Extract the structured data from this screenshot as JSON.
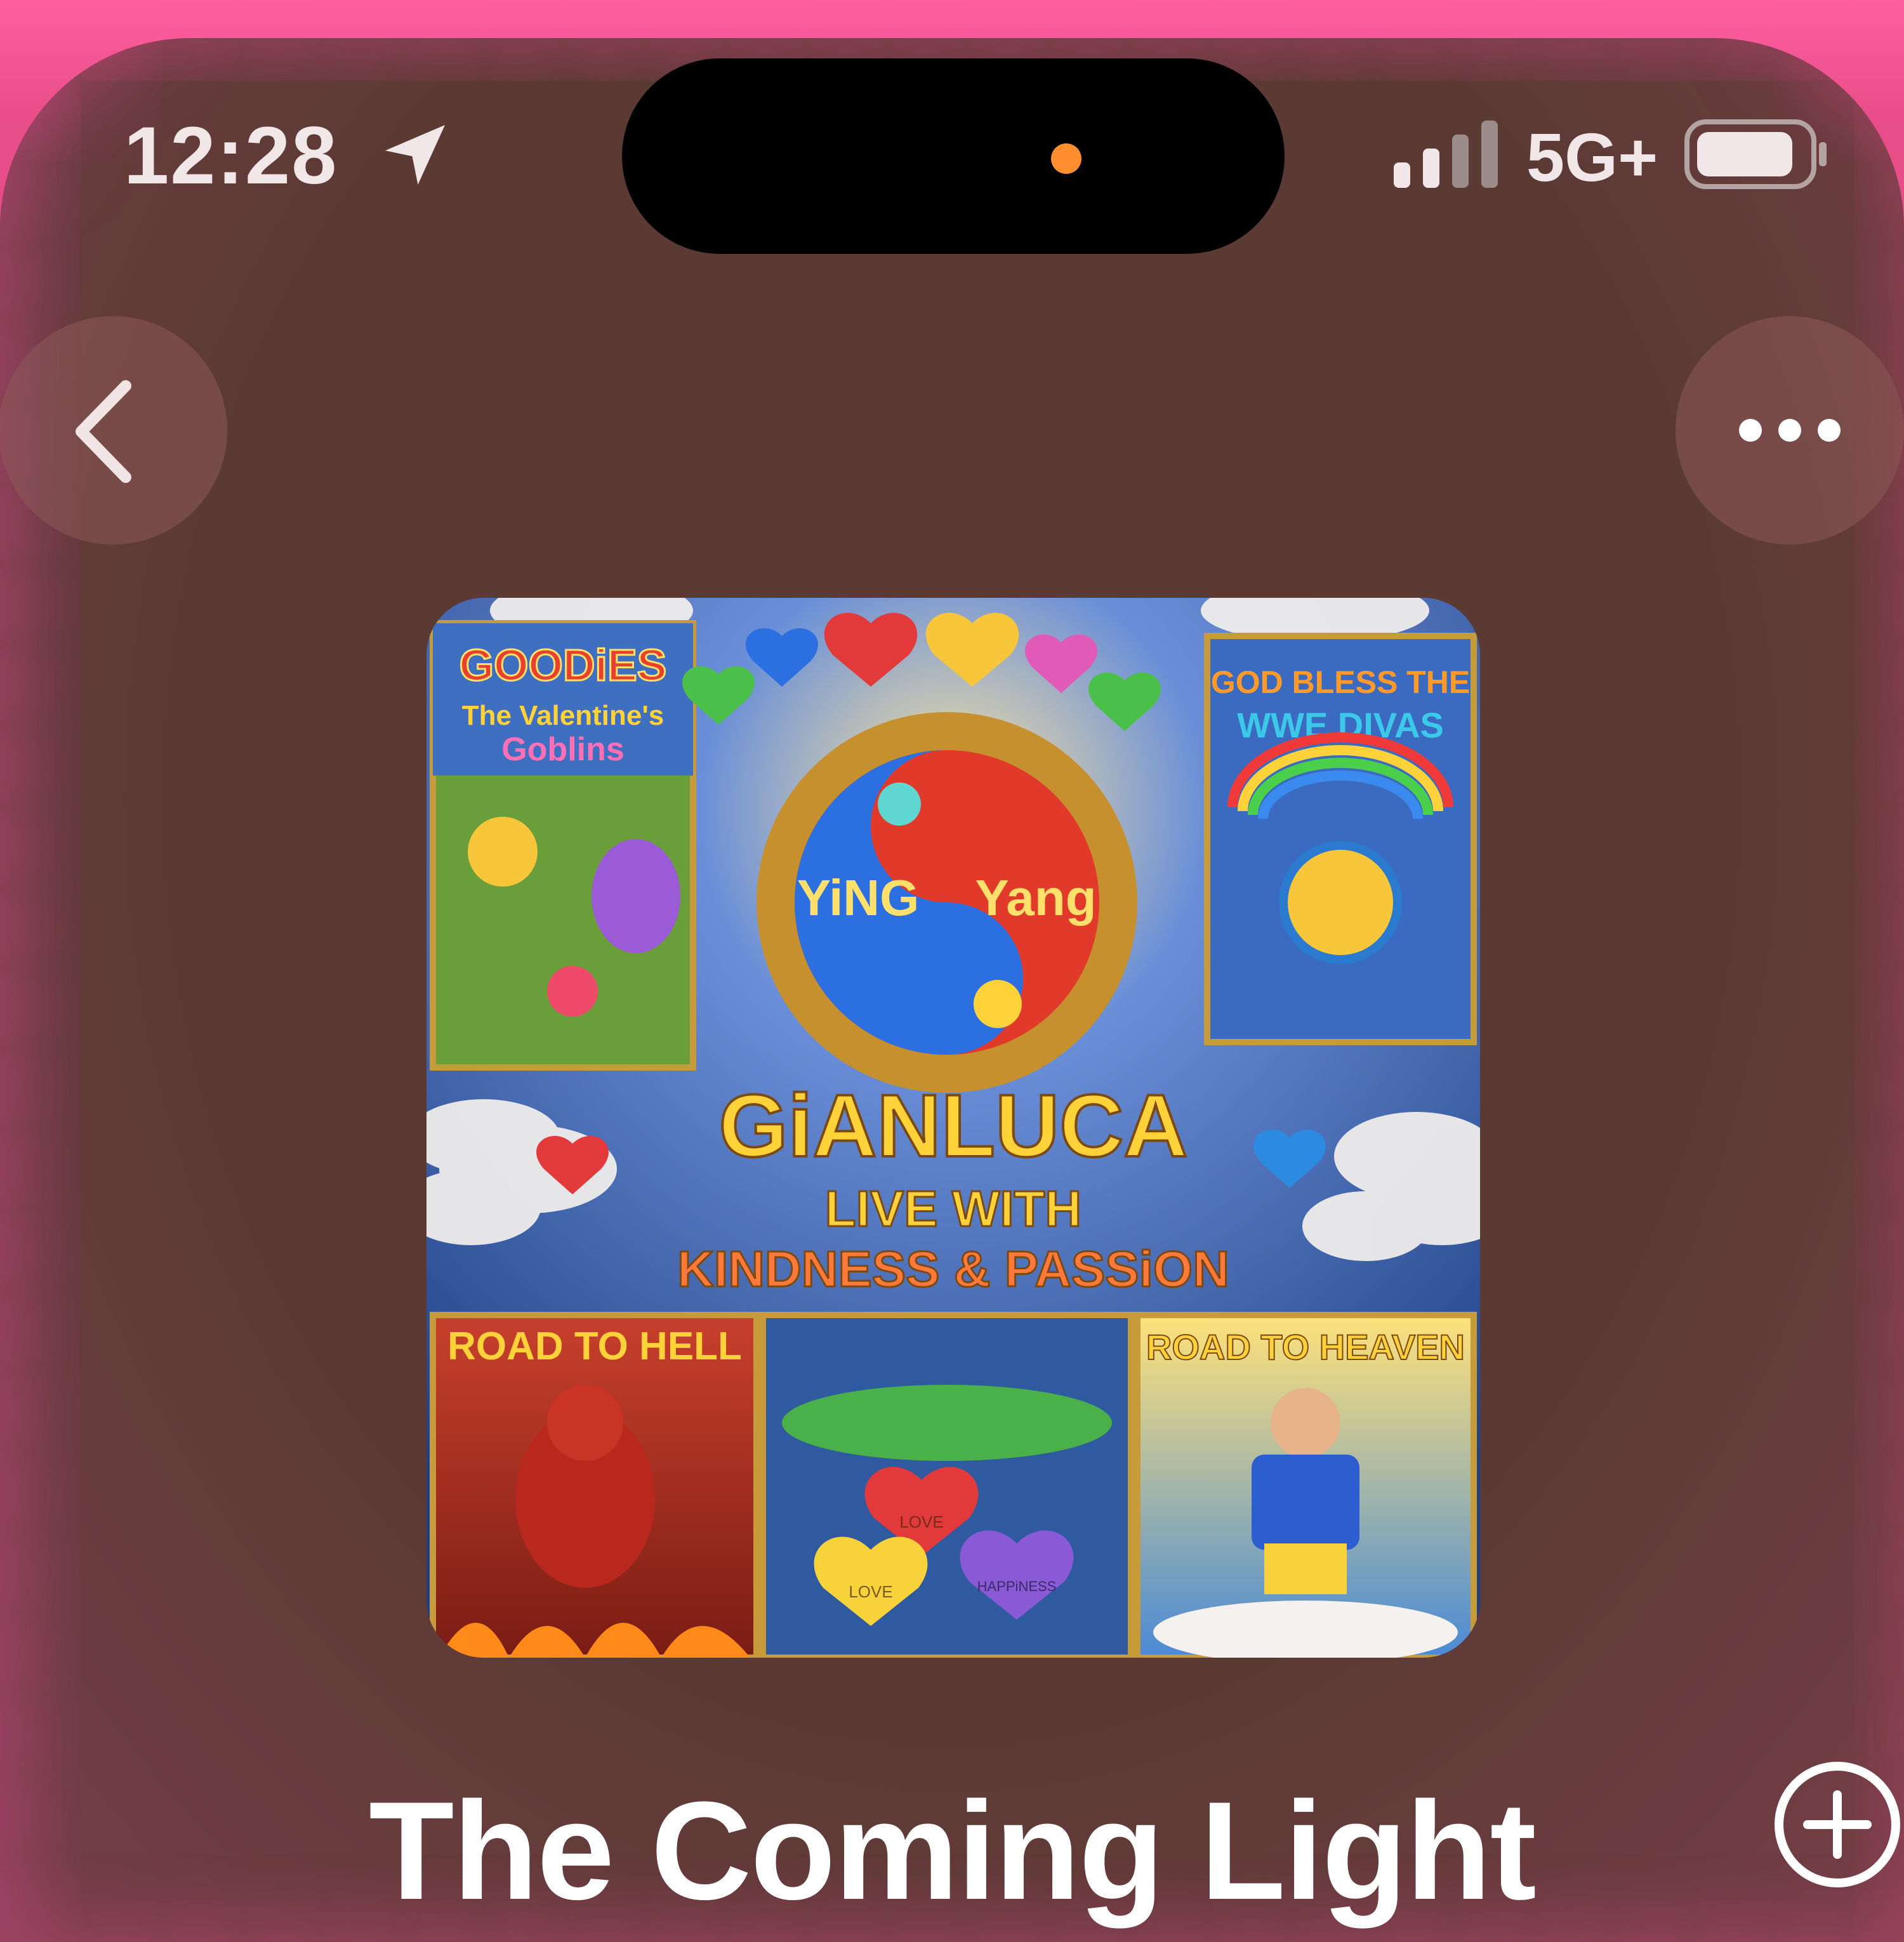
{
  "status_bar": {
    "time": "12:28",
    "network": "5G+",
    "location_icon": "location-arrow-icon",
    "signal_icon": "cellular-signal-icon",
    "battery_icon": "battery-icon"
  },
  "nav": {
    "back_icon": "chevron-left-icon",
    "more_icon": "ellipsis-icon"
  },
  "artwork": {
    "panel_top_left": [
      "GOODiES",
      "The Valentine's",
      "Goblins"
    ],
    "panel_top_right": [
      "GOD BLESS THE",
      "WWE DIVAS"
    ],
    "center_left": "YiNG",
    "center_right": "Yang",
    "headline": "GiANLUCA",
    "line2": "LIVE WITH",
    "line3": "KINDNESS & PASSiON",
    "panel_bottom_left": "ROAD TO HELL",
    "panel_bottom_right": "ROAD TO HEAVEN",
    "heart_labels": [
      "LOVE",
      "LOVE",
      "HAPPiNESS"
    ]
  },
  "track": {
    "title": "The Coming Light",
    "add_icon": "plus-circle-icon"
  },
  "colors": {
    "screen_bg": "#5a3a33",
    "edge_glow": "#f0569a",
    "text": "#ffffff"
  }
}
